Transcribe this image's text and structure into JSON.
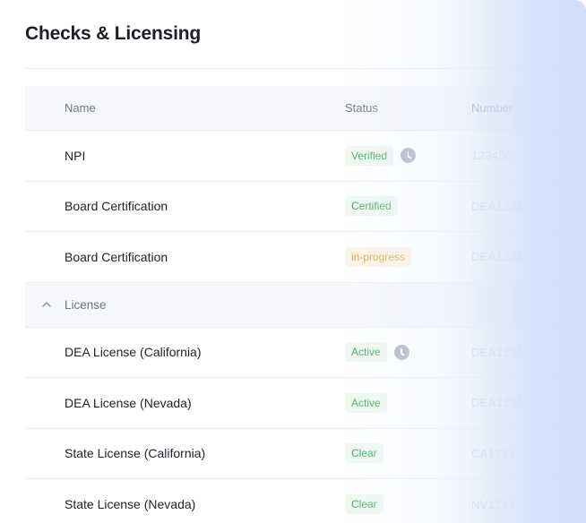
{
  "page": {
    "title": "Checks & Licensing"
  },
  "table": {
    "headers": {
      "name": "Name",
      "status": "Status",
      "number": "Number"
    },
    "rows": [
      {
        "name": "NPI",
        "status": "Verified",
        "number": "123456"
      },
      {
        "name": "Board Certification",
        "status": "Certified",
        "number": "DEA1234"
      },
      {
        "name": "Board Certification",
        "status": "in-progress",
        "number": "DEA1234"
      }
    ],
    "group": {
      "label": "License"
    },
    "license_rows": [
      {
        "name": "DEA License (California)",
        "status": "Active",
        "number": "DEA1234"
      },
      {
        "name": "DEA License (Nevada)",
        "status": "Active",
        "number": "DEA1234"
      },
      {
        "name": "State License (California)",
        "status": "Clear",
        "number": "CA1234"
      },
      {
        "name": "State License (Nevada)",
        "status": "Clear",
        "number": "NV1234"
      }
    ]
  },
  "colors": {
    "accent_green": "#47a866",
    "accent_amber": "#e2a23a",
    "fade": "#d3e0f9"
  },
  "icons": {
    "pending": "clock-icon",
    "group_toggle": "chevron-up-icon"
  }
}
